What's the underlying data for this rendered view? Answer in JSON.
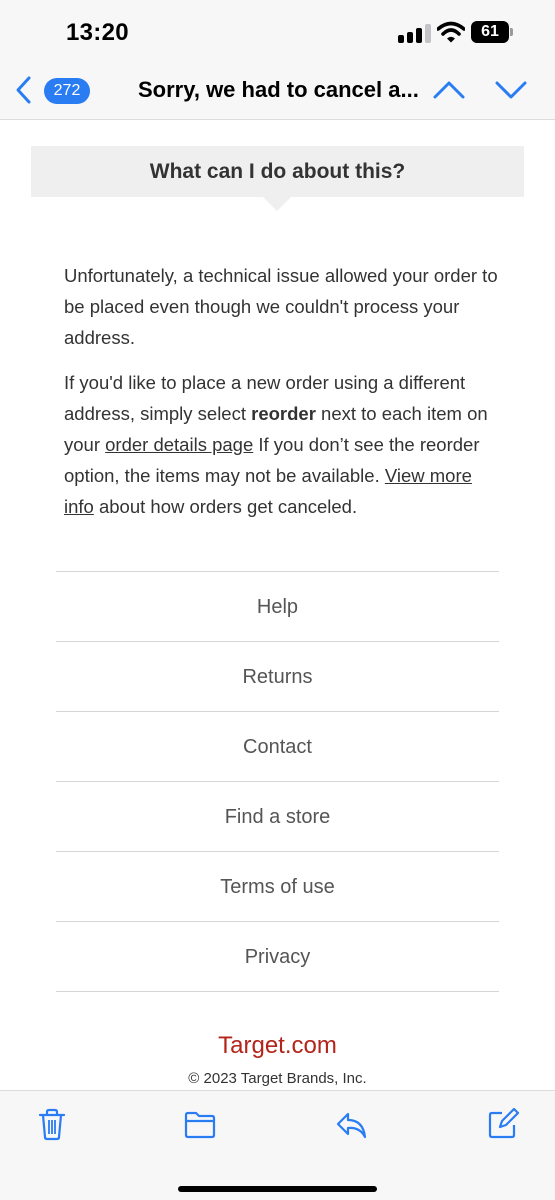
{
  "status_bar": {
    "time": "13:20",
    "battery_level": "61",
    "signal_bars_filled": 3,
    "signal_bars_total": 4,
    "icons": [
      "signal-icon",
      "wifi-icon",
      "battery-icon"
    ]
  },
  "nav": {
    "unread_count": "272",
    "subject": "Sorry, we had to cancel a...",
    "accent_color": "#2a7cf3",
    "icons": [
      "chevron-left-icon",
      "chevron-up-icon",
      "chevron-down-icon"
    ]
  },
  "email": {
    "callout_title": "What can I do about this?",
    "paragraph1": "Unfortunately, a technical issue allowed your order to be placed even though we couldn't process your address.",
    "paragraph2": {
      "part1": "If you'd like to place a new order using a different address, simply select ",
      "bold": "reorder",
      "part2": " next to each item on your ",
      "link1": "order details page",
      "part3": " If you don’t see the reorder option, the items may not be available. ",
      "link2": "View more info",
      "part4": " about how orders get canceled."
    },
    "footer_links": [
      "Help",
      "Returns",
      "Contact",
      "Find a store",
      "Terms of use",
      "Privacy"
    ],
    "brand_link": "Target.com",
    "brand_color": "#b3241a",
    "copyright": "© 2023 Target Brands, Inc."
  },
  "toolbar": {
    "icons": [
      "trash-icon",
      "folder-icon",
      "reply-icon",
      "compose-icon"
    ]
  }
}
